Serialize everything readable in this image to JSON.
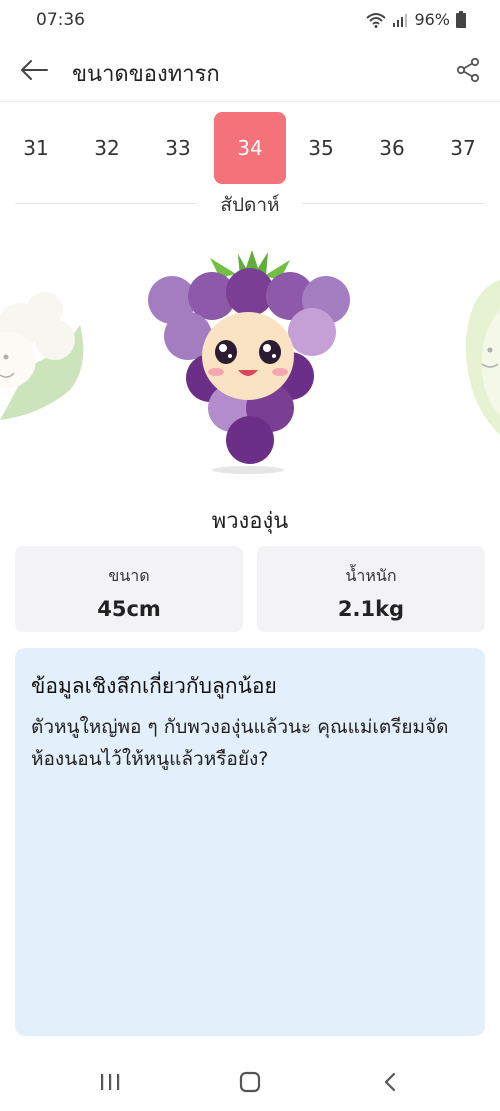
{
  "status": {
    "time": "07:36",
    "battery": "96%",
    "icons": [
      "wifi-icon",
      "signal-icon",
      "battery-icon"
    ]
  },
  "header": {
    "title": "ขนาดของทารก",
    "back_icon": "arrow-left-icon",
    "share_icon": "share-icon"
  },
  "weeks": {
    "items": [
      "31",
      "32",
      "33",
      "34",
      "35",
      "36",
      "37"
    ],
    "selected": "34",
    "label": "สัปดาห์"
  },
  "fruit": {
    "name": "พวงองุ่น",
    "icon": "grape-character-icon",
    "prev_icon": "cauliflower-icon",
    "next_icon": "lettuce-icon"
  },
  "stats": {
    "size_label": "ขนาด",
    "size_value": "45cm",
    "weight_label": "น้ำหนัก",
    "weight_value": "2.1kg"
  },
  "insight": {
    "title": "ข้อมูลเชิงลึกเกี่ยวกับลูกน้อย",
    "body": "ตัวหนูใหญ่พอ ๆ กับพวงองุ่นแล้วนะ คุณแม่เตรียมจัดห้องนอนไว้ให้หนูแล้วหรือยัง?"
  },
  "colors": {
    "accent": "#f4727a",
    "card_bg": "#f3f3f5",
    "insight_bg": "#e3f0fb",
    "grape_purple": "#7a3f95"
  },
  "nav": {
    "icons": [
      "recent-apps-icon",
      "home-icon",
      "back-icon"
    ]
  }
}
